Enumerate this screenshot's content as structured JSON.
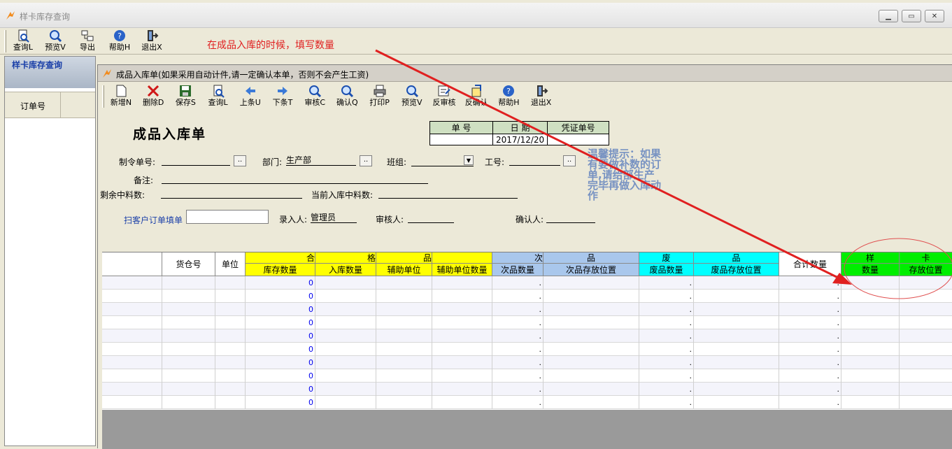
{
  "outer_window": {
    "title": "样卡库存查询",
    "toolbar": [
      {
        "label": "查询L",
        "icon": "query-icon"
      },
      {
        "label": "预览V",
        "icon": "preview-icon"
      },
      {
        "label": "导出",
        "icon": "export-icon"
      },
      {
        "label": "帮助H",
        "icon": "help-icon"
      },
      {
        "label": "退出X",
        "icon": "exit-icon"
      }
    ],
    "annotation": "在成品入库的时候，填写数量",
    "left_panel": {
      "title": "样卡库存查询",
      "column": "订单号"
    }
  },
  "inner_window": {
    "title": "成品入库单(如果采用自动计件,请一定确认本单，否则不会产生工资)",
    "toolbar": [
      {
        "label": "新增N",
        "icon": "new-icon"
      },
      {
        "label": "删除D",
        "icon": "delete-icon"
      },
      {
        "label": "保存S",
        "icon": "save-icon"
      },
      {
        "label": "查询L",
        "icon": "query-icon"
      },
      {
        "label": "上条U",
        "icon": "prev-icon"
      },
      {
        "label": "下条T",
        "icon": "next-icon"
      },
      {
        "label": "审核C",
        "icon": "audit-icon"
      },
      {
        "label": "确认Q",
        "icon": "confirm-icon"
      },
      {
        "label": "打印P",
        "icon": "print-icon"
      },
      {
        "label": "预览V",
        "icon": "preview-icon"
      },
      {
        "label": "反审核",
        "icon": "unaudit-icon"
      },
      {
        "label": "反确认",
        "icon": "unconfirm-icon"
      },
      {
        "label": "帮助H",
        "icon": "help-icon"
      },
      {
        "label": "退出X",
        "icon": "exit-icon"
      }
    ],
    "form": {
      "title": "成品入库单",
      "header_table": {
        "headers": [
          "单 号",
          "日 期",
          "凭证单号"
        ],
        "values": [
          "",
          "2017/12/20",
          ""
        ]
      },
      "fields": {
        "order_no_label": "制令单号:",
        "order_no_value": "",
        "dept_label": "部门:",
        "dept_value": "生产部",
        "team_label": "班组:",
        "team_value": "",
        "work_no_label": "工号:",
        "work_no_value": "",
        "remark_label": "备注:",
        "remark_value": "",
        "remain_label": "剩余中料数:",
        "remain_value": "",
        "current_label": "当前入库中料数:",
        "current_value": "",
        "scan_label": "扫客户订单填单",
        "scan_value": "",
        "entry_label": "录入人:",
        "entry_value": "管理员",
        "auditor_label": "审核人:",
        "auditor_value": "",
        "confirmer_label": "确认人:",
        "confirmer_value": ""
      },
      "tip": "温馨提示：如果有要做补数的订单,请给部生产完毕再做入库动作"
    },
    "grid": {
      "group_headers": {
        "good": [
          "合",
          "格",
          "品"
        ],
        "second": [
          "次",
          "品"
        ],
        "scrap": [
          "废",
          "品"
        ],
        "sample": [
          "样",
          "卡"
        ]
      },
      "columns": {
        "warehouse": "货仓号",
        "unit": "单位",
        "stock_qty": "库存数量",
        "in_qty": "入库数量",
        "aux_unit": "辅助单位",
        "aux_qty": "辅助单位数量",
        "second_qty": "次品数量",
        "second_loc": "次品存放位置",
        "scrap_qty": "废品数量",
        "scrap_loc": "废品存放位置",
        "total_qty": "合计数量",
        "sample_qty": "数量",
        "sample_loc": "存放位置"
      },
      "rows": [
        {
          "stock": "0",
          "dot": "."
        },
        {
          "stock": "0",
          "dot": "."
        },
        {
          "stock": "0",
          "dot": "."
        },
        {
          "stock": "0",
          "dot": "."
        },
        {
          "stock": "0",
          "dot": "."
        },
        {
          "stock": "0",
          "dot": "."
        },
        {
          "stock": "0",
          "dot": "."
        },
        {
          "stock": "0",
          "dot": "."
        },
        {
          "stock": "0",
          "dot": "."
        },
        {
          "stock": "0",
          "dot": "."
        }
      ]
    }
  },
  "colors": {
    "good_header": "#ffff00",
    "second_header": "#a9c7ec",
    "scrap_header": "#00ffff",
    "sample_header": "#00ee00",
    "annotation": "#e02020"
  }
}
